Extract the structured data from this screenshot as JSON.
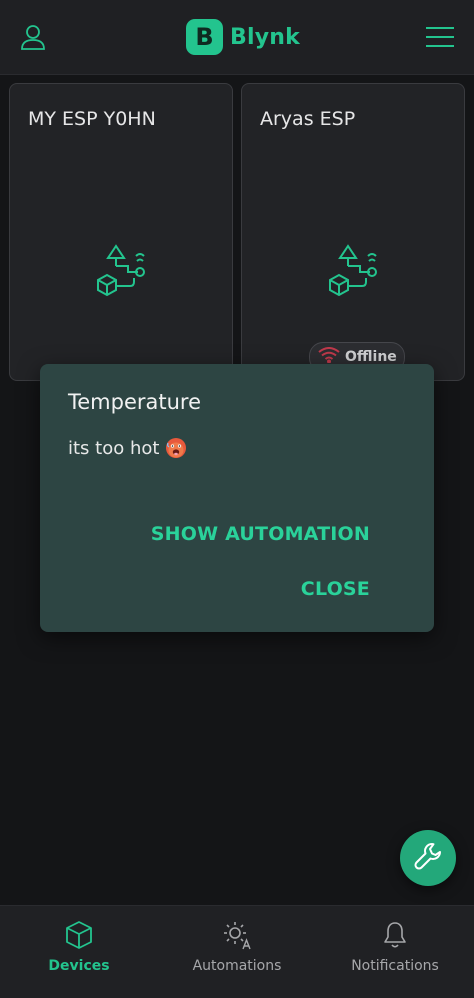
{
  "app": {
    "logo_letter": "B",
    "name": "Blynk",
    "accent": "#23c48e"
  },
  "header": {
    "user_icon": "user-icon",
    "menu_icon": "hamburger-menu-icon"
  },
  "devices": [
    {
      "name": "MY ESP Y0HN",
      "icon": "device-template-icon",
      "status": ""
    },
    {
      "name": "Aryas ESP",
      "icon": "device-template-icon",
      "status": "Offline"
    }
  ],
  "dialog": {
    "title": "Temperature",
    "message": "its too hot",
    "emoji": "hot-face-emoji",
    "show_automation_label": "SHOW AUTOMATION",
    "close_label": "CLOSE"
  },
  "fab": {
    "icon": "wrench-icon"
  },
  "bottom_nav": [
    {
      "label": "Devices",
      "icon": "cube-icon",
      "active": true
    },
    {
      "label": "Automations",
      "icon": "sun-automation-icon",
      "active": false
    },
    {
      "label": "Notifications",
      "icon": "bell-icon",
      "active": false
    }
  ],
  "colors": {
    "background": "#141517",
    "dialog": "#2d4543",
    "offline": "#c0394b"
  }
}
